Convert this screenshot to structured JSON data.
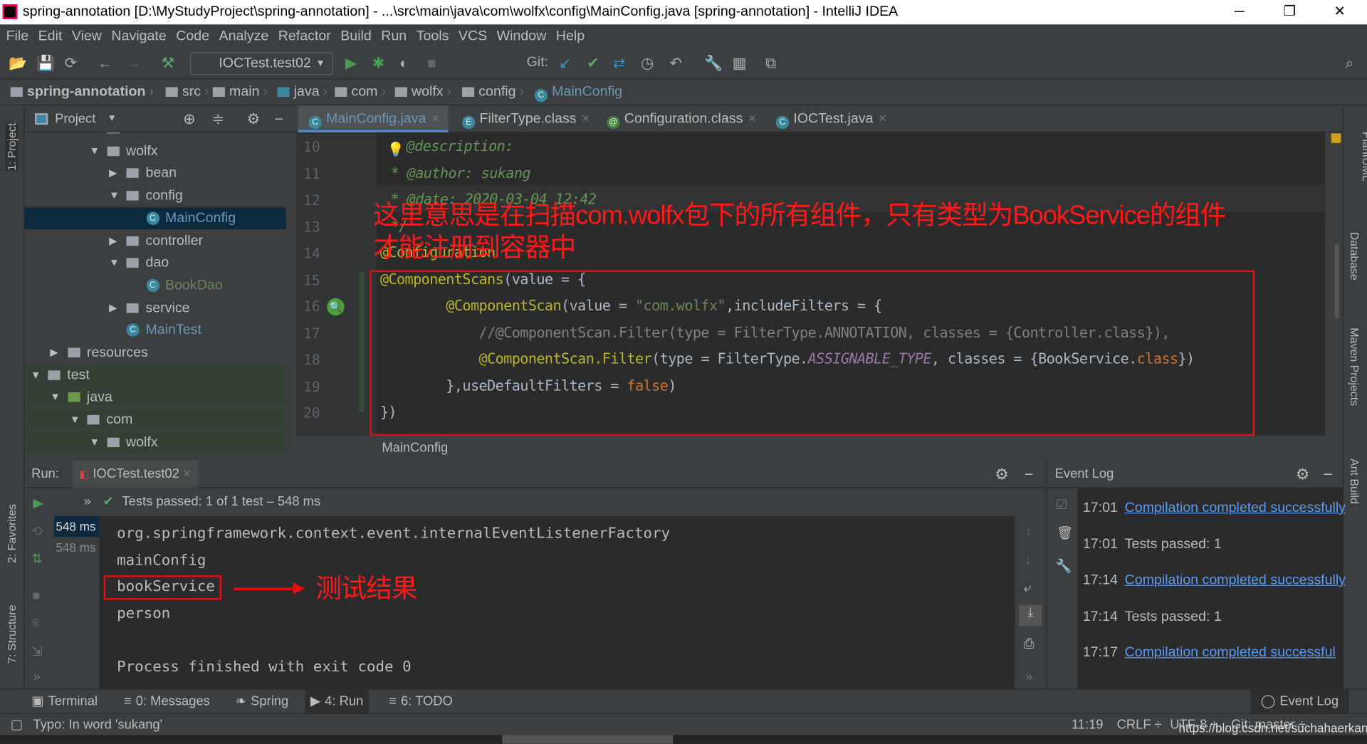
{
  "window": {
    "title": "spring-annotation [D:\\MyStudyProject\\spring-annotation] - ...\\src\\main\\java\\com\\wolfx\\config\\MainConfig.java [spring-annotation] - IntelliJ IDEA",
    "minimize": "─",
    "restore": "❐",
    "close": "✕"
  },
  "menu": [
    "File",
    "Edit",
    "View",
    "Navigate",
    "Code",
    "Analyze",
    "Refactor",
    "Build",
    "Run",
    "Tools",
    "VCS",
    "Window",
    "Help"
  ],
  "toolbar": {
    "run_config": "IOCTest.test02",
    "git_label": "Git:"
  },
  "breadcrumbs": [
    "spring-annotation",
    "src",
    "main",
    "java",
    "com",
    "wolfx",
    "config",
    "MainConfig"
  ],
  "left_strip": {
    "project": "1: Project",
    "favorites": "2: Favorites",
    "structure": "7: Structure"
  },
  "right_strip": {
    "plantuml": "PlantUML",
    "database": "Database",
    "maven": "Maven Projects",
    "ant": "Ant Build"
  },
  "project_panel": {
    "title": "Project",
    "tree": [
      {
        "label": "com",
        "depth": 5,
        "kind": "folder",
        "expanded": true
      },
      {
        "label": "wolfx",
        "depth": 5,
        "kind": "folder",
        "expanded": true
      },
      {
        "label": "bean",
        "depth": 6,
        "kind": "folder",
        "expanded": false
      },
      {
        "label": "config",
        "depth": 6,
        "kind": "folder",
        "expanded": true
      },
      {
        "label": "MainConfig",
        "depth": 7,
        "kind": "class",
        "selected": true
      },
      {
        "label": "controller",
        "depth": 6,
        "kind": "folder",
        "expanded": false
      },
      {
        "label": "dao",
        "depth": 6,
        "kind": "folder",
        "expanded": true
      },
      {
        "label": "BookDao",
        "depth": 7,
        "kind": "class"
      },
      {
        "label": "service",
        "depth": 6,
        "kind": "folder",
        "expanded": false
      },
      {
        "label": "MainTest",
        "depth": 6,
        "kind": "class"
      },
      {
        "label": "resources",
        "depth": 3,
        "kind": "folder",
        "expanded": false
      },
      {
        "label": "test",
        "depth": 2,
        "kind": "folder",
        "expanded": true
      },
      {
        "label": "java",
        "depth": 3,
        "kind": "srcfolder",
        "expanded": true
      },
      {
        "label": "com",
        "depth": 4,
        "kind": "folder",
        "expanded": true
      },
      {
        "label": "wolfx",
        "depth": 5,
        "kind": "folder",
        "expanded": true
      }
    ]
  },
  "editor_tabs": [
    {
      "label": "MainConfig.java",
      "active": true,
      "icon": "C"
    },
    {
      "label": "FilterType.class",
      "icon": "E"
    },
    {
      "label": "Configuration.class",
      "icon": "@"
    },
    {
      "label": "IOCTest.java",
      "icon": "C"
    }
  ],
  "code_lines": [
    {
      "n": "10",
      "html": "<span class='doc'>@description:</span>"
    },
    {
      "n": "11",
      "html": "<span class='doc'>* @author: sukang</span>"
    },
    {
      "n": "12",
      "html": "<span class='doc'>* @date: 2020-03-04 12:42</span>"
    },
    {
      "n": "13",
      "html": "<span class='doc'>*/</span>"
    },
    {
      "n": "14",
      "html": "<span class='ann'>@Configuration</span>"
    },
    {
      "n": "15",
      "html": "<span class='ann'>@ComponentScans</span>(value = {"
    },
    {
      "n": "16",
      "html": "        <span class='ann'>@ComponentScan</span>(value = <span class='str'>\"com.wolfx\"</span>,includeFilters = {"
    },
    {
      "n": "17",
      "html": "            <span class='cm'>//@ComponentScan.Filter(type = FilterType.ANNOTATION, classes = {Controller.class}),</span>"
    },
    {
      "n": "18",
      "html": "            <span class='ann'>@ComponentScan.Filter</span>(type = FilterType.<span class='it'>ASSIGNABLE_TYPE</span>, classes = {BookService.<span class='kw'>class</span>})"
    },
    {
      "n": "19",
      "html": "        },useDefaultFilters = <span class='kw'>false</span>)"
    },
    {
      "n": "20",
      "html": "})"
    }
  ],
  "editor_breadcrumb": "MainConfig",
  "annotation": {
    "line1": "这里意思是在扫描com.wolfx包下的所有组件，只有类型为BookService的组件",
    "line2": "才能注册到容器中",
    "result": "测试结果",
    "color": "#ff1a1a"
  },
  "run_panel": {
    "label": "Run:",
    "tab": "IOCTest.test02",
    "status": "Tests passed: 1 of 1 test – 548 ms",
    "durations": [
      "548 ms",
      "548 ms"
    ],
    "output": [
      "org.springframework.context.event.internalEventListenerFactory",
      "mainConfig",
      "bookService",
      "person",
      "",
      "Process finished with exit code 0"
    ]
  },
  "event_log": {
    "title": "Event Log",
    "entries": [
      {
        "time": "17:01",
        "text": "Compilation completed successfully",
        "link": true
      },
      {
        "time": "17:01",
        "text": "Tests passed: 1",
        "link": false
      },
      {
        "time": "17:14",
        "text": "Compilation completed successfully",
        "link": true
      },
      {
        "time": "17:14",
        "text": "Tests passed: 1",
        "link": false
      },
      {
        "time": "17:17",
        "text": "Compilation completed successful",
        "link": true
      }
    ]
  },
  "bottom_tabs": [
    {
      "label": "Terminal",
      "icon": "▣"
    },
    {
      "label": "0: Messages",
      "icon": "≡"
    },
    {
      "label": "Spring",
      "icon": "❧"
    },
    {
      "label": "4: Run",
      "icon": "▶",
      "active": true
    },
    {
      "label": "6: TODO",
      "icon": "≡"
    }
  ],
  "bottom_right": "Event Log",
  "status": {
    "message": "Typo: In word 'sukang'",
    "position": "11:19",
    "line_sep": "CRLF ÷",
    "encoding": "UTF-8 ÷",
    "git": "Git: master ÷",
    "watermark": "https://blog.csdn.net/suchahaerkang"
  }
}
